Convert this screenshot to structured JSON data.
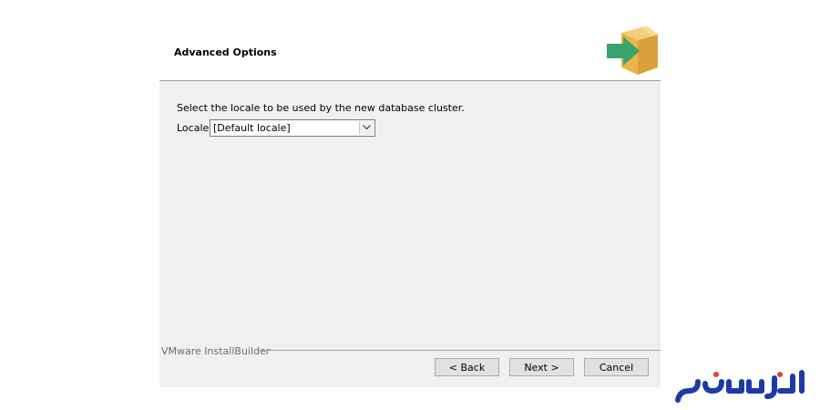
{
  "header": {
    "title": "Advanced Options",
    "logo_icon": "installer-box-arrow-icon"
  },
  "content": {
    "prompt": "Select the locale to be used by the new database cluster.",
    "locale_label": "Locale",
    "locale_selected": "[Default locale]"
  },
  "footer": {
    "brand": "VMware InstallBuilder",
    "back_label": "< Back",
    "next_label": "Next >",
    "cancel_label": "Cancel"
  },
  "watermark": {
    "text": "ایران سرور",
    "color": "#1e3aa8"
  },
  "colors": {
    "accent_arrow": "#3aa36d",
    "box": "#e8b54a",
    "panel": "#f0f0f0"
  }
}
